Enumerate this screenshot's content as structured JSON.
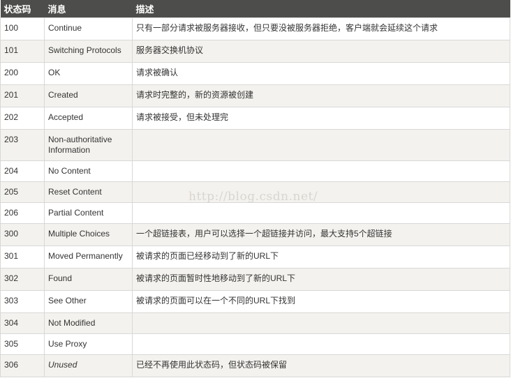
{
  "headers": [
    "状态码",
    "消息",
    "描述"
  ],
  "rows": [
    {
      "code": "100",
      "message": "Continue",
      "description": "只有一部分请求被服务器接收，但只要没被服务器拒绝，客户端就会延续这个请求"
    },
    {
      "code": "101",
      "message": "Switching Protocols",
      "description": "服务器交换机协议"
    },
    {
      "code": "200",
      "message": "OK",
      "description": "请求被确认"
    },
    {
      "code": "201",
      "message": "Created",
      "description": "请求时完整的，新的资源被创建"
    },
    {
      "code": "202",
      "message": "Accepted",
      "description": "请求被接受，但未处理完"
    },
    {
      "code": "203",
      "message": "Non-authoritative Information",
      "description": ""
    },
    {
      "code": "204",
      "message": "No Content",
      "description": ""
    },
    {
      "code": "205",
      "message": "Reset Content",
      "description": ""
    },
    {
      "code": "206",
      "message": "Partial Content",
      "description": ""
    },
    {
      "code": "300",
      "message": "Multiple Choices",
      "description": "一个超链接表，用户可以选择一个超链接并访问，最大支持5个超链接"
    },
    {
      "code": "301",
      "message": "Moved Permanently",
      "description": "被请求的页面已经移动到了新的URL下"
    },
    {
      "code": "302",
      "message": "Found",
      "description": "被请求的页面暂时性地移动到了新的URL下"
    },
    {
      "code": "303",
      "message": "See Other",
      "description": "被请求的页面可以在一个不同的URL下找到"
    },
    {
      "code": "304",
      "message": "Not Modified",
      "description": ""
    },
    {
      "code": "305",
      "message": "Use Proxy",
      "description": ""
    },
    {
      "code": "306",
      "message": "Unused",
      "description": "已经不再使用此状态码，但状态码被保留",
      "italic": true
    }
  ],
  "watermark": "http://blog.csdn.net/"
}
